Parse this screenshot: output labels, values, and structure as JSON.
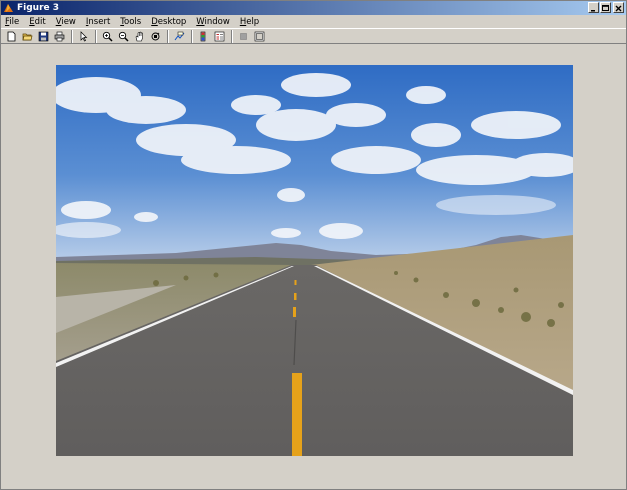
{
  "window": {
    "title": "Figure 3"
  },
  "menu": [
    {
      "key": "F",
      "rest": "ile"
    },
    {
      "key": "E",
      "rest": "dit"
    },
    {
      "key": "V",
      "rest": "iew"
    },
    {
      "key": "I",
      "rest": "nsert"
    },
    {
      "key": "T",
      "rest": "ools"
    },
    {
      "key": "D",
      "rest": "esktop"
    },
    {
      "key": "W",
      "rest": "indow"
    },
    {
      "key": "H",
      "rest": "elp"
    }
  ],
  "toolbar_icons": [
    "new-figure-icon",
    "open-file-icon",
    "save-icon",
    "print-icon",
    "edit-plot-arrow-icon",
    "zoom-in-icon",
    "zoom-out-icon",
    "pan-hand-icon",
    "rotate-3d-icon",
    "data-cursor-icon",
    "insert-colorbar-icon",
    "insert-legend-icon",
    "hide-plot-tools-icon",
    "show-plot-tools-icon"
  ],
  "image": {
    "description_tag": "road-photo",
    "colors": {
      "sky_top": "#3b74c4",
      "sky_bottom": "#b9cde6",
      "road": "#6e6c6b",
      "center_line": "#e6a21a",
      "edge_line": "#f2f2f2",
      "desert": "#b9a88a"
    }
  }
}
